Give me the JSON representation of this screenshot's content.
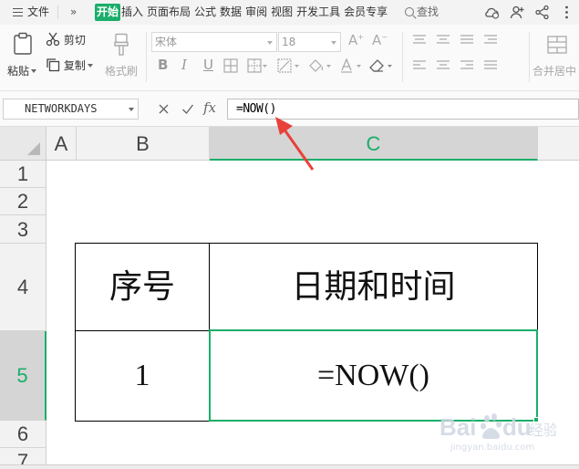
{
  "menubar": {
    "file": "文件",
    "more": "»",
    "active_tab": "开始",
    "tabs": [
      "插入",
      "页面布局",
      "公式",
      "数据",
      "审阅",
      "视图",
      "开发工具",
      "会员专享"
    ],
    "search": "查找"
  },
  "toolbar": {
    "paste": "粘贴",
    "cut": "剪切",
    "copy": "复制",
    "format_painter": "格式刷",
    "font_name": "宋体",
    "font_size": "18",
    "bold": "B",
    "italic": "I",
    "underline": "U",
    "merge_center": "合并居中"
  },
  "formula_bar": {
    "name_box": "NETWORKDAYS",
    "formula": "=NOW()",
    "fx": "fx"
  },
  "grid": {
    "columns": [
      "A",
      "B",
      "C"
    ],
    "selected_column": "C",
    "rows": [
      "1",
      "2",
      "3",
      "4",
      "5",
      "6",
      "7"
    ],
    "selected_row": "5",
    "cells": {
      "b4": "序号",
      "c4": "日期和时间",
      "b5": "1",
      "c5": "=NOW()"
    }
  },
  "watermark": {
    "text": "Baidu经验",
    "url": "jingyan.baidu.com"
  },
  "colors": {
    "accent": "#1aae6a",
    "annotation_arrow": "#e8413a"
  }
}
